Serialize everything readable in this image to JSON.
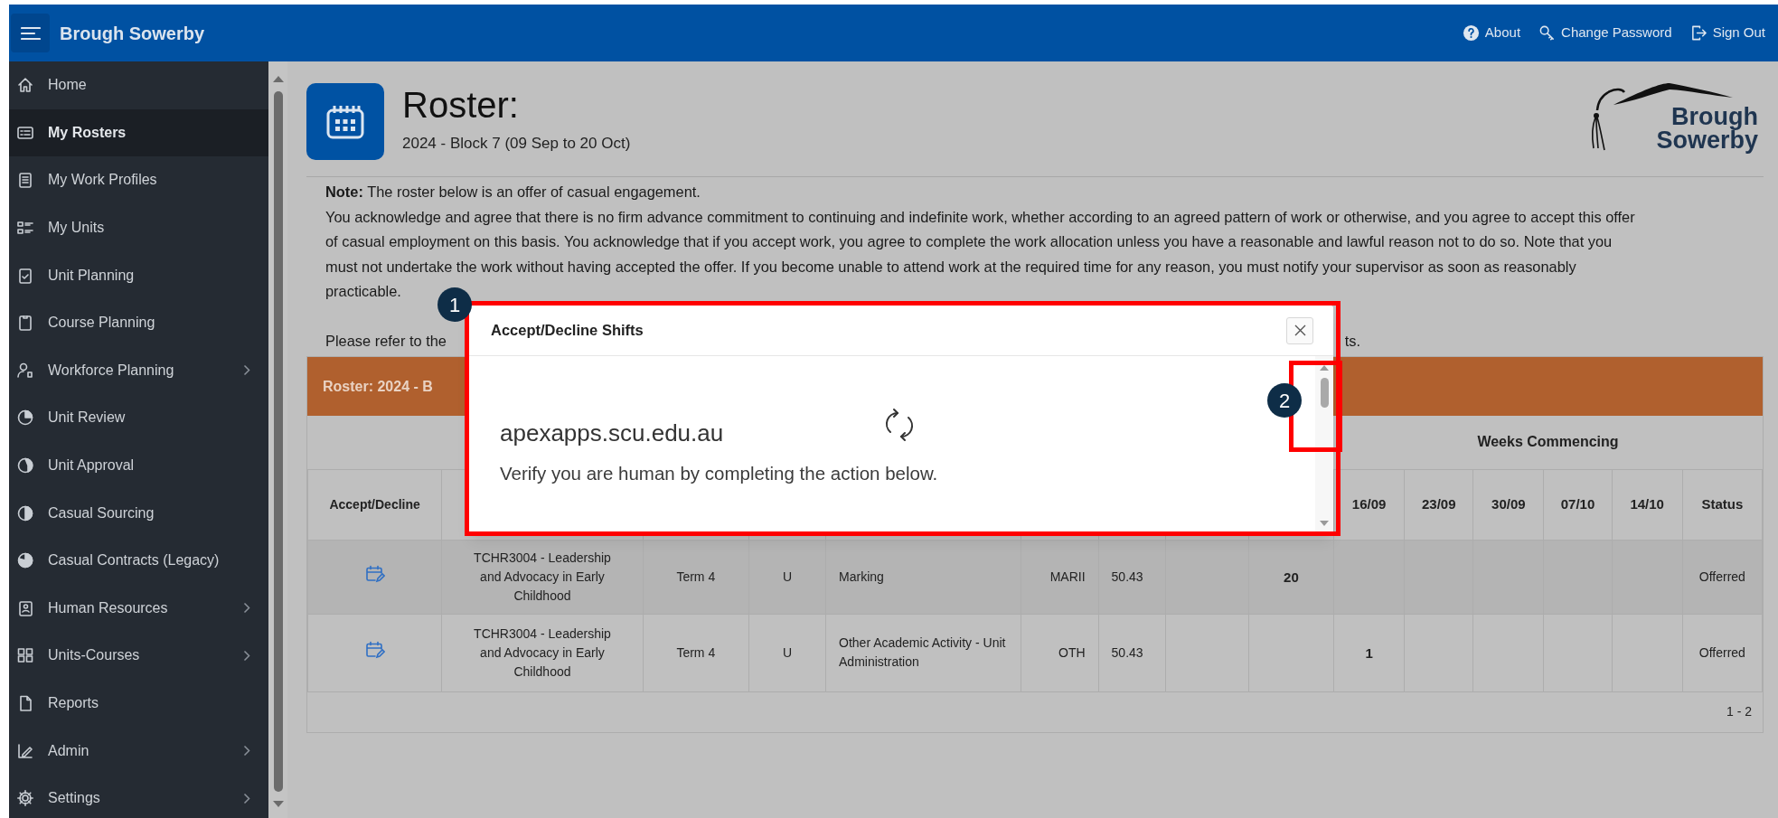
{
  "header": {
    "app_title": "Brough Sowerby",
    "links": [
      {
        "label": "About"
      },
      {
        "label": "Change Password"
      },
      {
        "label": "Sign Out"
      }
    ]
  },
  "sidebar": {
    "items": [
      {
        "label": "Home",
        "selected": false,
        "has_submenu": false
      },
      {
        "label": "My Rosters",
        "selected": true,
        "has_submenu": false
      },
      {
        "label": "My Work Profiles",
        "selected": false,
        "has_submenu": false
      },
      {
        "label": "My Units",
        "selected": false,
        "has_submenu": false
      },
      {
        "label": "Unit Planning",
        "selected": false,
        "has_submenu": false
      },
      {
        "label": "Course Planning",
        "selected": false,
        "has_submenu": false
      },
      {
        "label": "Workforce Planning",
        "selected": false,
        "has_submenu": true
      },
      {
        "label": "Unit Review",
        "selected": false,
        "has_submenu": false
      },
      {
        "label": "Unit Approval",
        "selected": false,
        "has_submenu": false
      },
      {
        "label": "Casual Sourcing",
        "selected": false,
        "has_submenu": false
      },
      {
        "label": "Casual Contracts (Legacy)",
        "selected": false,
        "has_submenu": false
      },
      {
        "label": "Human Resources",
        "selected": false,
        "has_submenu": true
      },
      {
        "label": "Units-Courses",
        "selected": false,
        "has_submenu": true
      },
      {
        "label": "Reports",
        "selected": false,
        "has_submenu": false
      },
      {
        "label": "Admin",
        "selected": false,
        "has_submenu": true
      },
      {
        "label": "Settings",
        "selected": false,
        "has_submenu": true
      }
    ]
  },
  "page": {
    "title": "Roster:",
    "subtitle": "2024 - Block 7 (09 Sep to 20 Oct)",
    "logo": {
      "line_1": "Brough",
      "line_2": "Sowerby"
    },
    "note": {
      "lead": "**Note:** The roster below is an offer of casual engagement.",
      "body": "You acknowledge and agree that there is no firm advance commitment to continuing and indefinite work, whether according to an agreed pattern of work or otherwise, and you agree to accept this offer of casual employment on this basis. You acknowledge that if you accept work, you agree to complete the work allocation unless you have a reasonable and lawful reason not to do so. Note that you must not undertake the work without having accepted the offer. If you become unable to attend work at the required time for any reason, you must notify your supervisor as soon as reasonably practicable.",
      "refer_start": "Please refer to the",
      "refer_end": "ts."
    }
  },
  "roster_region": {
    "title": "Roster: 2024 - B",
    "header": {
      "group": "Weeks Commencing",
      "column_1": "Accept/Decline",
      "column_10": "16/09",
      "column_11": "23/09",
      "column_12": "30/09",
      "column_13": "07/10",
      "column_14": "14/10",
      "column_15": "Status"
    },
    "rows": [
      {
        "hovered": true,
        "cells": {
          "column_2": "TCHR3004 - Leadership and Advocacy in Early Childhood",
          "column_3": "Term 4",
          "column_4": "U",
          "column_5": "Marking",
          "column_6": "MARII",
          "column_7": "50.43",
          "column_9": "20",
          "column_15": "Offerred"
        }
      },
      {
        "hovered": false,
        "cells": {
          "column_2": "TCHR3004 - Leadership and Advocacy in Early Childhood",
          "column_3": "Term 4",
          "column_4": "U",
          "column_5": "Other Academic Activity - Unit Administration",
          "column_6": "OTH",
          "column_7": "50.43",
          "column_10": "1",
          "column_15": "Offerred"
        }
      }
    ],
    "pagination": "1 - 2"
  },
  "dialog": {
    "title": "Accept/Decline Shifts",
    "site": "apexapps.scu.edu.au",
    "message": "Verify you are human by completing the action below."
  },
  "annotations": [
    {
      "label": "1",
      "kind": "dialog"
    },
    {
      "label": "2",
      "kind": "scrollbar"
    }
  ]
}
